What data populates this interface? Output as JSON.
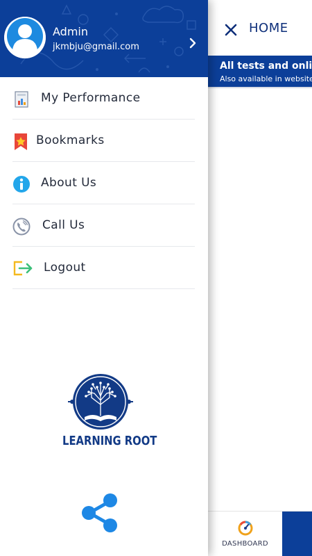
{
  "app": {
    "header": {
      "title": "HOME"
    },
    "banner": {
      "line1": "All tests and online",
      "line2": "Also available in website"
    },
    "bottom_nav": {
      "dashboard_label": "DASHBOARD"
    }
  },
  "drawer": {
    "user": {
      "name": "Admin",
      "email": "jkmbju@gmail.com"
    },
    "menu": [
      {
        "label": "My Performance",
        "icon": "performance-report-icon"
      },
      {
        "label": "Bookmarks",
        "icon": "bookmark-star-icon"
      },
      {
        "label": "About Us",
        "icon": "info-icon"
      },
      {
        "label": "Call Us",
        "icon": "phone-icon"
      },
      {
        "label": "Logout",
        "icon": "logout-icon"
      }
    ],
    "logo_text": "LEARNING ROOT",
    "share_icon": "share-icon"
  },
  "colors": {
    "brand_blue": "#0c3f99",
    "logo_blue": "#123a86",
    "share_blue": "#1e88e5",
    "text_dark": "#232a3a"
  }
}
